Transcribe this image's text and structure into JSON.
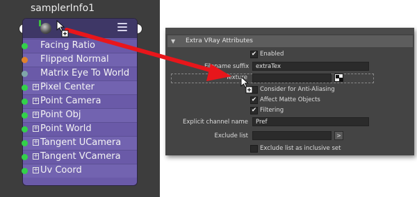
{
  "node": {
    "title": "samplerInfo1",
    "rows": [
      {
        "label": "Facing Ratio",
        "port_color": "#33d14a",
        "expandable": false
      },
      {
        "label": "Flipped Normal",
        "port_color": "#e0822b",
        "expandable": false
      },
      {
        "label": "Matrix Eye To World",
        "port_color": "#7fa6a8",
        "expandable": false
      },
      {
        "label": "Pixel Center",
        "port_color": "#33d14a",
        "expandable": true
      },
      {
        "label": "Point Camera",
        "port_color": "#33d14a",
        "expandable": true
      },
      {
        "label": "Point Obj",
        "port_color": "#33d14a",
        "expandable": true
      },
      {
        "label": "Point World",
        "port_color": "#33d14a",
        "expandable": true
      },
      {
        "label": "Tangent UCamera",
        "port_color": "#33d14a",
        "expandable": true
      },
      {
        "label": "Tangent VCamera",
        "port_color": "#33d14a",
        "expandable": true
      },
      {
        "label": "Uv Coord",
        "port_color": "#33d14a",
        "expandable": true
      }
    ],
    "expander_glyph": "+"
  },
  "attribute_editor": {
    "section_title": "Extra VRay Attributes",
    "section_arrow": "▼",
    "enabled_label": "Enabled",
    "enabled": true,
    "filename_suffix_label": "Filename suffix",
    "filename_suffix_value": "extraTex",
    "texture_label": "Texture",
    "texture_value": "",
    "consider_aa_label": "Consider for Anti-Aliasing",
    "consider_aa": false,
    "affect_matte_label": "Affect Matte Objects",
    "affect_matte": true,
    "filtering_label": "Filtering",
    "filtering": true,
    "explicit_channel_label": "Explicit channel name",
    "explicit_channel_value": "Pref",
    "exclude_list_label": "Exclude list",
    "exclude_list_value": "",
    "exclude_button_glyph": ">",
    "inclusive_label": "Exclude list as inclusive set",
    "inclusive": false,
    "checkmark": "✔"
  },
  "colors": {
    "drag_arrow": "#e8161b",
    "node_body": "#6a5aa8",
    "node_header": "#3e3766"
  },
  "icons": [
    "sphere-icon",
    "menu-icon",
    "cursor-icon",
    "checker-map-icon",
    "drag-arrow"
  ]
}
